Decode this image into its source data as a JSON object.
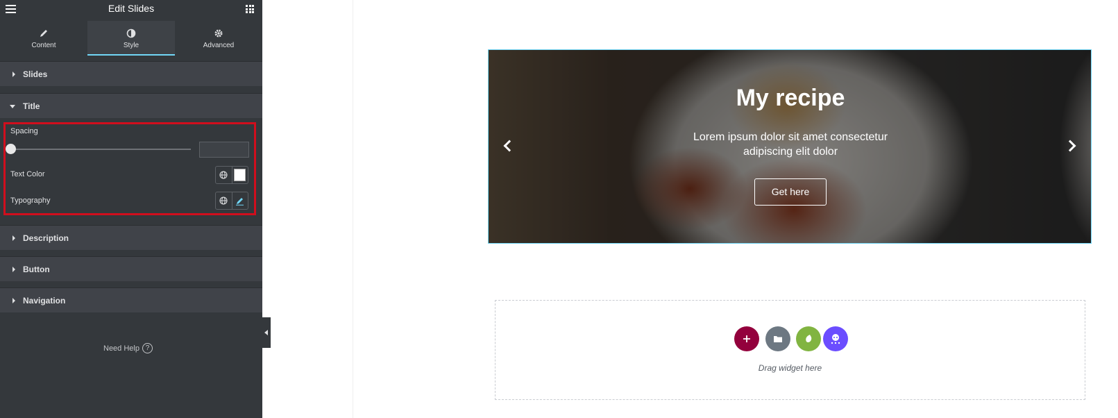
{
  "panel": {
    "title": "Edit Slides",
    "tabs": [
      {
        "label": "Content",
        "icon": "pencil-icon"
      },
      {
        "label": "Style",
        "icon": "half-circle-icon",
        "active": true
      },
      {
        "label": "Advanced",
        "icon": "gear-icon"
      }
    ],
    "sections": {
      "slides": "Slides",
      "title": "Title",
      "description": "Description",
      "button": "Button",
      "navigation": "Navigation"
    },
    "title_controls": {
      "spacing_label": "Spacing",
      "spacing_value": "",
      "text_color_label": "Text Color",
      "text_color": "#ffffff",
      "typography_label": "Typography"
    },
    "need_help": "Need Help",
    "colors": {
      "accent": "#71d7f7",
      "highlight": "#d10e1d",
      "panel_bg": "#34383c"
    }
  },
  "canvas": {
    "slide": {
      "title": "My recipe",
      "description": "Lorem ipsum dolor sit amet consectetur adipiscing elit dolor",
      "button_label": "Get here"
    },
    "drop_zone": {
      "text": "Drag widget here",
      "buttons": [
        "add-icon",
        "folder-icon",
        "envato-icon",
        "ai-icon"
      ]
    }
  }
}
